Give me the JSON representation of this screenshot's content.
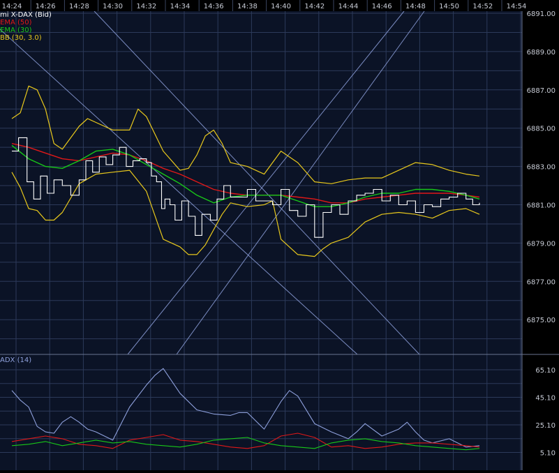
{
  "colors": {
    "background": "#000000",
    "plot_background": "#0b1326",
    "grid": "#2c3a5a",
    "axis_text": "#c8ccd6",
    "price": "#ffffff",
    "ema50": "#e01818",
    "ema30": "#18c818",
    "bollinger": "#e8c81c",
    "adx": "#8ea0dc",
    "plus_di": "#18c818",
    "minus_di": "#e01818",
    "trendline": "#8ea0dc",
    "legend_adx": "#8ea0dc"
  },
  "chart_data": [
    {
      "type": "line",
      "panel": "price",
      "legend": [
        {
          "label": "mi X-DAX (Bid)",
          "color": "#ffffff"
        },
        {
          "label": "EMA (50)",
          "color": "#e01818"
        },
        {
          "label": "EMA (30)",
          "color": "#18c818"
        },
        {
          "label": "BB (30, 3.0)",
          "color": "#e8c81c"
        }
      ],
      "x_ticks": [
        "14:24",
        "14:26",
        "14:28",
        "14:30",
        "14:32",
        "14:34",
        "14:36",
        "14:38",
        "14:40",
        "14:42",
        "14:44",
        "14:46",
        "14:48",
        "14:50",
        "14:52",
        "14:54"
      ],
      "y_ticks": [
        "6891.00",
        "6889.00",
        "6887.00",
        "6885.00",
        "6883.00",
        "6881.00",
        "6879.00",
        "6877.00",
        "6875.00"
      ],
      "x_range_minutes": [
        864.0,
        895.6
      ],
      "y_range": [
        6872.0,
        6891.35
      ],
      "grid": true,
      "series": [
        {
          "key": "price",
          "x": [
            864.0,
            864.4,
            864.9,
            865.3,
            865.7,
            866.1,
            866.5,
            867.0,
            867.5,
            868.0,
            868.4,
            868.8,
            869.2,
            869.6,
            870.0,
            870.4,
            870.8,
            871.2,
            871.6,
            872.0,
            872.3,
            872.6,
            872.9,
            873.1,
            873.4,
            873.7,
            874.1,
            874.5,
            874.9,
            875.3,
            875.8,
            876.2,
            876.6,
            877.0,
            877.5,
            878.0,
            878.5,
            879.0,
            879.5,
            880.0,
            880.5,
            881.0,
            881.5,
            882.0,
            882.5,
            883.0,
            883.5,
            884.0,
            884.5,
            885.0,
            885.5,
            886.0,
            886.5,
            887.0,
            887.5,
            888.0,
            888.5,
            889.0,
            889.5,
            890.0,
            890.5,
            891.0,
            891.4,
            891.8
          ],
          "y": [
            6883.8,
            6884.5,
            6882.2,
            6881.3,
            6882.5,
            6881.6,
            6882.3,
            6882.0,
            6881.5,
            6882.3,
            6883.3,
            6882.7,
            6883.5,
            6883.1,
            6883.6,
            6884.0,
            6883.0,
            6883.3,
            6883.4,
            6883.2,
            6882.5,
            6882.2,
            6880.8,
            6881.3,
            6881.0,
            6880.2,
            6881.2,
            6880.4,
            6879.4,
            6880.5,
            6880.2,
            6881.3,
            6882.0,
            6881.4,
            6881.4,
            6881.8,
            6881.2,
            6881.2,
            6881.0,
            6881.8,
            6880.7,
            6880.4,
            6881.0,
            6879.3,
            6880.6,
            6881.0,
            6880.5,
            6881.2,
            6881.5,
            6881.6,
            6881.8,
            6881.2,
            6881.5,
            6881.0,
            6881.2,
            6880.6,
            6881.0,
            6880.9,
            6881.3,
            6881.4,
            6881.6,
            6881.3,
            6881.0,
            6881.1
          ]
        },
        {
          "key": "ema50",
          "x": [
            864.0,
            865.0,
            866.0,
            867.0,
            868.0,
            869.0,
            870.0,
            871.0,
            872.0,
            873.0,
            874.0,
            875.0,
            876.0,
            877.0,
            878.0,
            879.0,
            880.0,
            881.0,
            882.0,
            883.0,
            884.0,
            885.0,
            886.0,
            887.0,
            888.0,
            889.0,
            890.0,
            891.0,
            891.8
          ],
          "y": [
            6884.2,
            6884.0,
            6883.7,
            6883.4,
            6883.3,
            6883.5,
            6883.7,
            6883.6,
            6883.3,
            6882.9,
            6882.6,
            6882.2,
            6881.8,
            6881.6,
            6881.5,
            6881.5,
            6881.5,
            6881.4,
            6881.3,
            6881.1,
            6881.1,
            6881.3,
            6881.4,
            6881.5,
            6881.6,
            6881.6,
            6881.6,
            6881.5,
            6881.4
          ]
        },
        {
          "key": "ema30",
          "x": [
            864.0,
            865.0,
            866.0,
            867.0,
            868.0,
            869.0,
            870.0,
            871.0,
            872.0,
            873.0,
            874.0,
            875.0,
            876.0,
            877.0,
            878.0,
            879.0,
            880.0,
            881.0,
            882.0,
            883.0,
            884.0,
            885.0,
            886.0,
            887.0,
            888.0,
            889.0,
            890.0,
            891.0,
            891.8
          ],
          "y": [
            6884.1,
            6883.4,
            6883.0,
            6882.9,
            6883.3,
            6883.8,
            6883.9,
            6883.6,
            6883.1,
            6882.6,
            6882.1,
            6881.5,
            6881.1,
            6881.4,
            6881.5,
            6881.5,
            6881.5,
            6881.2,
            6880.9,
            6880.9,
            6881.1,
            6881.4,
            6881.6,
            6881.6,
            6881.8,
            6881.8,
            6881.7,
            6881.5,
            6881.3
          ]
        },
        {
          "key": "bb_upper",
          "x": [
            864.0,
            864.5,
            865.0,
            865.5,
            866.0,
            866.5,
            867.0,
            867.5,
            868.0,
            868.5,
            869.0,
            870.0,
            871.0,
            871.5,
            872.0,
            873.0,
            874.0,
            874.5,
            875.0,
            875.5,
            876.0,
            876.5,
            877.0,
            878.0,
            879.0,
            880.0,
            881.0,
            882.0,
            883.0,
            884.0,
            885.0,
            886.0,
            887.0,
            888.0,
            889.0,
            890.0,
            891.0,
            891.8
          ],
          "y": [
            6885.5,
            6885.8,
            6887.2,
            6887.0,
            6886.0,
            6884.2,
            6883.9,
            6884.5,
            6885.1,
            6885.5,
            6885.3,
            6884.9,
            6884.9,
            6886.0,
            6885.6,
            6883.8,
            6882.8,
            6882.9,
            6883.6,
            6884.6,
            6884.9,
            6884.2,
            6883.2,
            6883.0,
            6882.6,
            6883.8,
            6883.2,
            6882.2,
            6882.1,
            6882.3,
            6882.4,
            6882.4,
            6882.8,
            6883.2,
            6883.1,
            6882.8,
            6882.6,
            6882.5
          ]
        },
        {
          "key": "bb_lower",
          "x": [
            864.0,
            864.5,
            865.0,
            865.5,
            866.0,
            866.5,
            867.0,
            868.0,
            869.0,
            870.0,
            871.0,
            872.0,
            873.0,
            874.0,
            874.5,
            875.0,
            875.5,
            876.0,
            876.5,
            877.0,
            878.0,
            879.0,
            879.5,
            880.0,
            881.0,
            882.0,
            882.5,
            883.0,
            884.0,
            885.0,
            886.0,
            887.0,
            888.0,
            889.0,
            890.0,
            891.0,
            891.8
          ],
          "y": [
            6882.7,
            6881.9,
            6880.8,
            6880.7,
            6880.2,
            6880.2,
            6880.6,
            6882.1,
            6882.6,
            6882.7,
            6882.8,
            6881.7,
            6879.2,
            6878.8,
            6878.4,
            6878.4,
            6878.9,
            6879.7,
            6880.5,
            6881.1,
            6880.9,
            6881.0,
            6881.2,
            6879.2,
            6878.4,
            6878.3,
            6878.7,
            6879.0,
            6879.3,
            6880.1,
            6880.5,
            6880.6,
            6880.5,
            6880.3,
            6880.7,
            6880.8,
            6880.5
          ]
        }
      ]
    },
    {
      "type": "line",
      "panel": "adx",
      "legend": [
        {
          "label": "ADX (14)",
          "color": "#8ea0dc"
        }
      ],
      "y_ticks": [
        "65.10",
        "45.10",
        "25.10",
        "5.10"
      ],
      "y_range": [
        0.0,
        71.0
      ],
      "grid": true,
      "series": [
        {
          "key": "adx",
          "x": [
            864.0,
            864.5,
            865.0,
            865.5,
            866.0,
            866.5,
            867.0,
            867.5,
            868.0,
            868.5,
            869.0,
            870.0,
            871.0,
            872.0,
            872.5,
            873.0,
            874.0,
            875.0,
            876.0,
            877.0,
            877.5,
            878.0,
            879.0,
            880.0,
            880.5,
            881.0,
            882.0,
            883.0,
            884.0,
            884.5,
            885.0,
            886.0,
            887.0,
            887.5,
            888.0,
            888.5,
            889.0,
            890.0,
            891.0,
            891.8
          ],
          "y": [
            50,
            43,
            38,
            24,
            20,
            19,
            27,
            31,
            27,
            22,
            20,
            14,
            38,
            54,
            61,
            66,
            48,
            36,
            33,
            32,
            34,
            34,
            22,
            42,
            50,
            46,
            26,
            20,
            15,
            20,
            26,
            17,
            22,
            27,
            20,
            14,
            12,
            15,
            9,
            10
          ]
        },
        {
          "key": "plus_di",
          "x": [
            864.0,
            865.0,
            866.0,
            867.0,
            868.0,
            869.0,
            870.0,
            871.0,
            872.0,
            873.0,
            874.0,
            875.0,
            876.0,
            877.0,
            878.0,
            879.0,
            880.0,
            881.0,
            882.0,
            883.0,
            884.0,
            885.0,
            886.0,
            887.0,
            888.0,
            889.0,
            890.0,
            891.0,
            891.8
          ],
          "y": [
            10,
            11,
            13,
            10,
            12,
            14,
            12,
            13,
            11,
            10,
            9,
            11,
            14,
            15,
            16,
            12,
            10,
            9,
            8,
            12,
            14,
            15,
            13,
            12,
            10,
            9,
            8,
            7,
            8
          ]
        },
        {
          "key": "minus_di",
          "x": [
            864.0,
            865.0,
            866.0,
            867.0,
            868.0,
            869.0,
            870.0,
            871.0,
            872.0,
            873.0,
            874.0,
            875.0,
            876.0,
            877.0,
            878.0,
            879.0,
            880.0,
            881.0,
            882.0,
            883.0,
            884.0,
            885.0,
            886.0,
            887.0,
            888.0,
            889.0,
            890.0,
            891.0,
            891.8
          ],
          "y": [
            13,
            15,
            17,
            15,
            11,
            10,
            8,
            14,
            16,
            18,
            14,
            13,
            11,
            9,
            8,
            10,
            17,
            19,
            16,
            9,
            10,
            8,
            9,
            11,
            12,
            12,
            11,
            10,
            9
          ]
        }
      ]
    }
  ]
}
